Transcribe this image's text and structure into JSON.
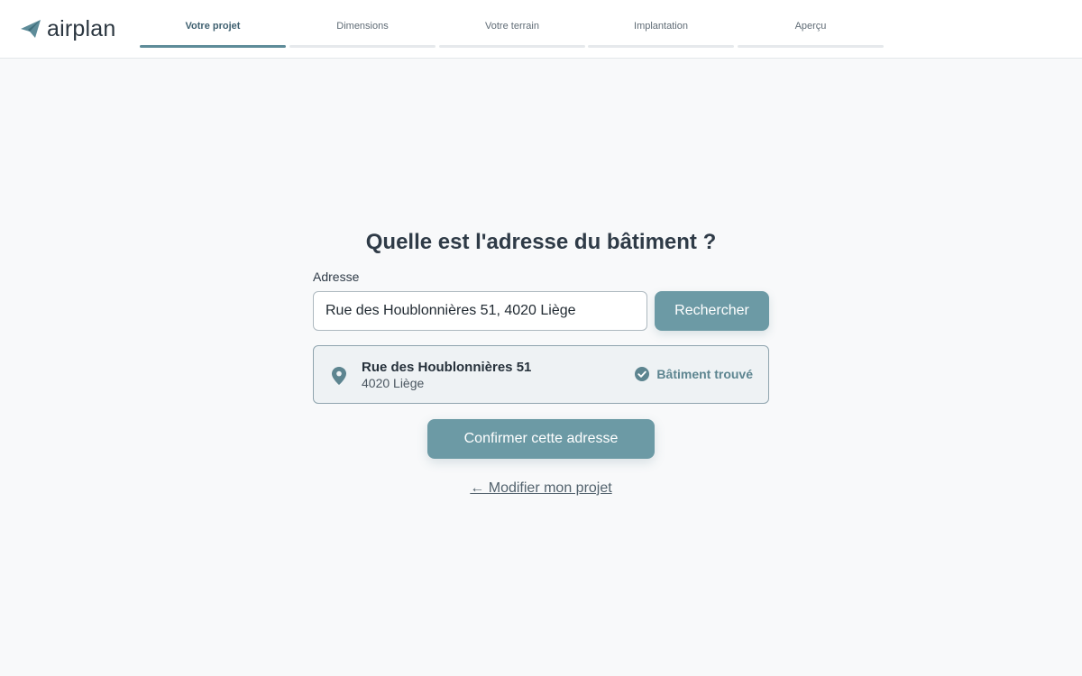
{
  "brand": {
    "name": "airplan",
    "icon": "paper-plane-icon",
    "color": "#5e8c99"
  },
  "steps": [
    {
      "label": "Votre projet",
      "active": true
    },
    {
      "label": "Dimensions",
      "active": false
    },
    {
      "label": "Votre terrain",
      "active": false
    },
    {
      "label": "Implantation",
      "active": false
    },
    {
      "label": "Aperçu",
      "active": false
    }
  ],
  "main": {
    "title": "Quelle est l'adresse du bâtiment ?",
    "address_label": "Adresse",
    "address_value": "Rue des Houblonnières 51, 4020 Liège",
    "search_label": "Rechercher",
    "result": {
      "street": "Rue des Houblonnières 51",
      "city": "4020 Liège",
      "status": "Bâtiment trouvé",
      "pin_icon": "map-pin-icon",
      "status_icon": "check-circle-icon"
    },
    "confirm_label": "Confirmer cette adresse",
    "back_label": "← Modifier mon projet"
  },
  "colors": {
    "accent": "#6c9aa5",
    "background": "#f8f9fa",
    "text": "#2f3b47"
  }
}
